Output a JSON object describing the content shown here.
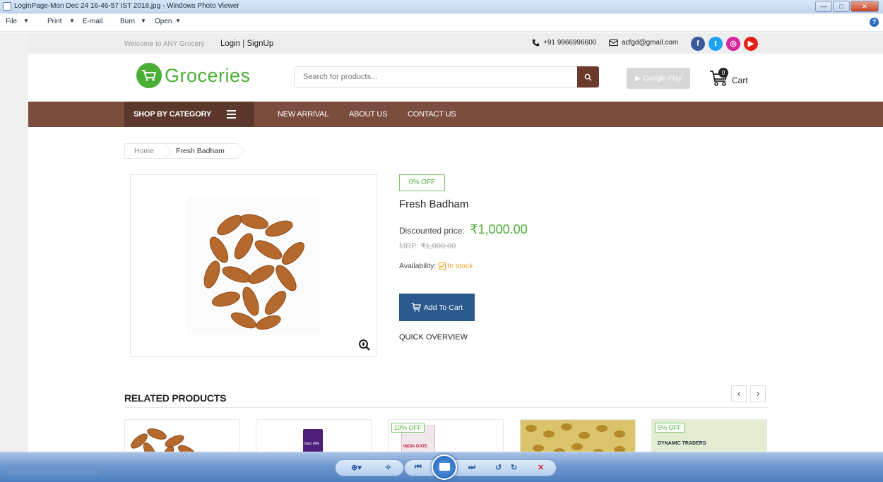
{
  "window": {
    "title": "LoginPage-Mon Dec 24 16-46-57 IST 2018.jpg - Windows Photo Viewer",
    "menu": [
      "File",
      "Print",
      "E-mail",
      "Burn",
      "Open"
    ]
  },
  "topbar": {
    "welcome": "Welcome to ANY Grocery",
    "login_signup": "Login | SignUp",
    "phone": "+91 9966996600",
    "email": "acfgd@gmail.com"
  },
  "header": {
    "logo_text": "Groceries",
    "search_placeholder": "Search for products...",
    "gplay_label": "Google Play",
    "cart_count": "0",
    "cart_label": "Cart"
  },
  "nav": {
    "shop_by_category": "SHOP BY CATEGORY",
    "links": [
      "NEW ARRIVAL",
      "ABOUT US",
      "CONTACT US"
    ]
  },
  "breadcrumb": [
    "Home",
    "Fresh Badham"
  ],
  "product": {
    "discount": "0% OFF",
    "name": "Fresh Badham",
    "discounted_label": "Discounted price:",
    "discounted_price": "₹1,000.00",
    "mrp_label": "MRP:",
    "mrp": "₹1,000.00",
    "availability_label": "Availability:",
    "availability": "In stock",
    "add_to_cart": "Add To Cart",
    "quick_overview": "QUICK OVERVIEW"
  },
  "related": {
    "title": "RELATED PRODUCTS",
    "cards": [
      {
        "badge": "",
        "caption": ""
      },
      {
        "badge": "",
        "caption": "Dairy Milk"
      },
      {
        "badge": "10% OFF",
        "caption": "INDIA GATE"
      },
      {
        "badge": "",
        "caption": ""
      },
      {
        "badge": "5% OFF",
        "caption": "DYNAMIC TRADERS"
      }
    ]
  },
  "colors": {
    "brand_green": "#4caf35",
    "nav_brown": "#7b4d3f",
    "category_brown": "#5c372c",
    "cta_blue": "#2c5a8f",
    "stock_orange": "#f0a020"
  }
}
